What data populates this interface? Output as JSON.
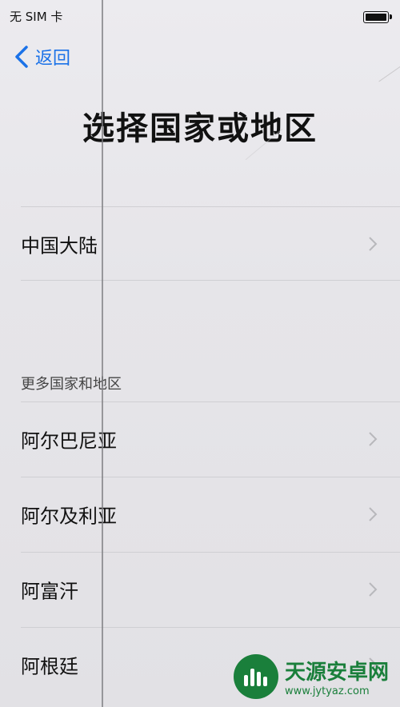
{
  "status_bar": {
    "carrier": "无 SIM 卡"
  },
  "nav": {
    "back_label": "返回"
  },
  "page": {
    "title": "选择国家或地区"
  },
  "primary_items": [
    {
      "label": "中国大陆"
    }
  ],
  "more_section": {
    "header": "更多国家和地区",
    "items": [
      {
        "label": "阿尔巴尼亚"
      },
      {
        "label": "阿尔及利亚"
      },
      {
        "label": "阿富汗"
      },
      {
        "label": "阿根廷"
      }
    ]
  },
  "watermark": {
    "text_cn": "天源安卓网",
    "text_en": "www.jytyaz.com"
  },
  "colors": {
    "accent": "#1b72e8",
    "background": "#e8e6ea",
    "watermark": "#1a7f3b"
  }
}
